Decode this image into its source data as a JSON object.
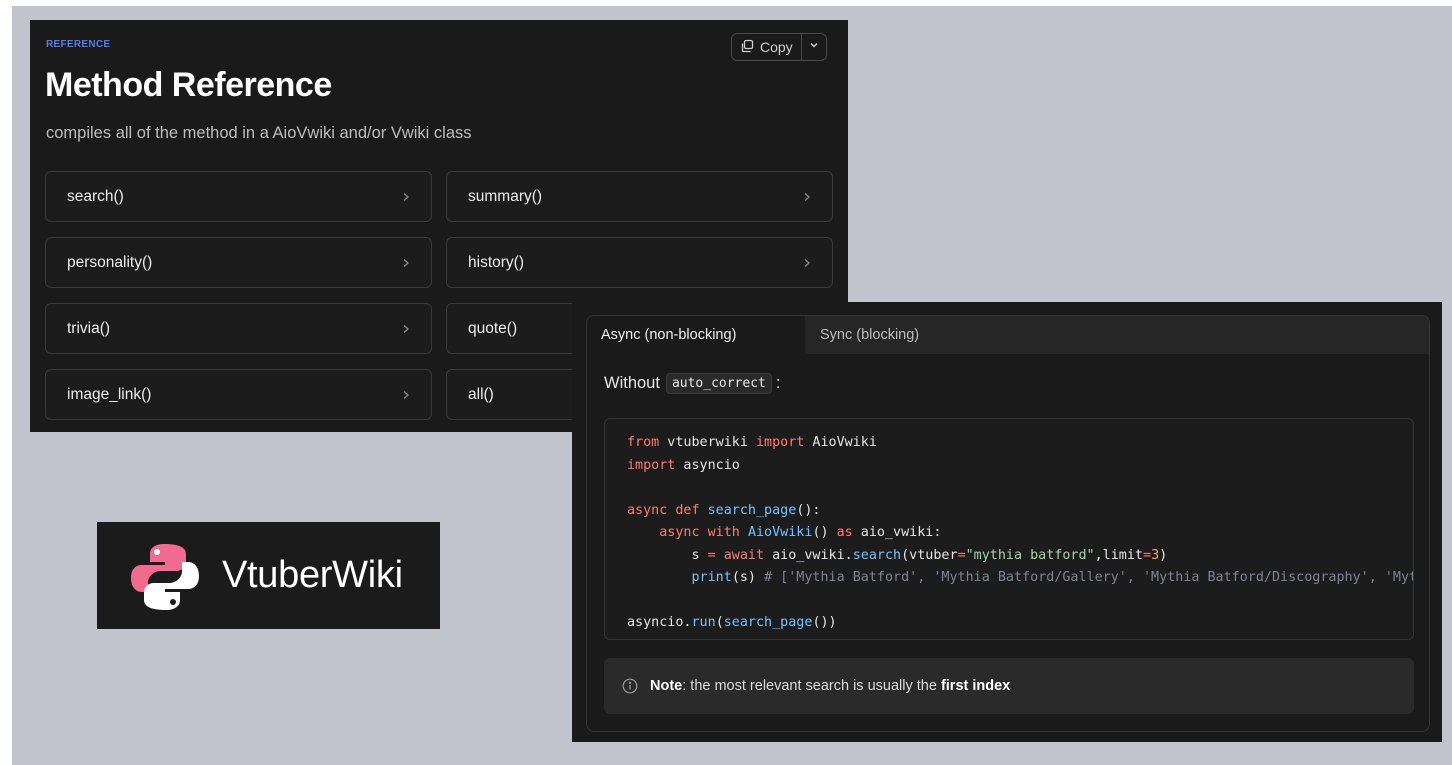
{
  "reference": {
    "eyebrow": "REFERENCE",
    "title": "Method Reference",
    "description": "compiles all of the method in a AioVwiki and/or Vwiki class",
    "copy_label": "Copy",
    "methods": [
      {
        "label": "search()"
      },
      {
        "label": "summary()"
      },
      {
        "label": "personality()"
      },
      {
        "label": "history()"
      },
      {
        "label": "trivia()"
      },
      {
        "label": "quote()"
      },
      {
        "label": "image_link()"
      },
      {
        "label": "all()"
      }
    ]
  },
  "logo": {
    "text": "VtuberWiki",
    "icon": "python-logo-icon"
  },
  "code_panel": {
    "tabs": [
      {
        "label": "Async (non-blocking)",
        "active": true
      },
      {
        "label": "Sync (blocking)",
        "active": false
      }
    ],
    "without_prefix": "Without",
    "inline_code": "auto_correct",
    "without_suffix": ":",
    "code": {
      "l1_from": "from",
      "l1_mod": " vtuberwiki ",
      "l1_import": "import",
      "l1_name": " AioVwiki",
      "l2_import": "import",
      "l2_mod": " asyncio",
      "l4_async": "async",
      "l4_def": " def ",
      "l4_fn": "search_page",
      "l4_rest": "():",
      "l5_indent": "    ",
      "l5_async_with": "async with",
      "l5_space": " ",
      "l5_cls": "AioVwiki",
      "l5_paren": "() ",
      "l5_as": "as",
      "l5_rest": " aio_vwiki:",
      "l6_indent": "        s ",
      "l6_eq": "=",
      "l6_space": " ",
      "l6_await": "await",
      "l6_obj": " aio_vwiki.",
      "l6_method": "search",
      "l6_args1": "(vtuber",
      "l6_eq2": "=",
      "l6_str": "\"mythia batford\"",
      "l6_args2": ",limit",
      "l6_eq3": "=",
      "l6_num": "3",
      "l6_close": ")",
      "l7_indent": "        ",
      "l7_print": "print",
      "l7_args": "(s) ",
      "l7_comment": "# ['Mythia Batford', 'Mythia Batford/Gallery', 'Mythia Batford/Discography', 'Mythia Batford/Trivia']",
      "l9_mod": "asyncio.",
      "l9_run": "run",
      "l9_open": "(",
      "l9_fn": "search_page",
      "l9_close": "())"
    },
    "note": {
      "label": "Note",
      "text": ": the most relevant search is usually the ",
      "emphasis": "first index"
    }
  },
  "colors": {
    "backdrop": "#c2c4cd",
    "panel": "#1a1a1a",
    "accent": "#4f7ef0",
    "logo_pink": "#f06b8f"
  }
}
